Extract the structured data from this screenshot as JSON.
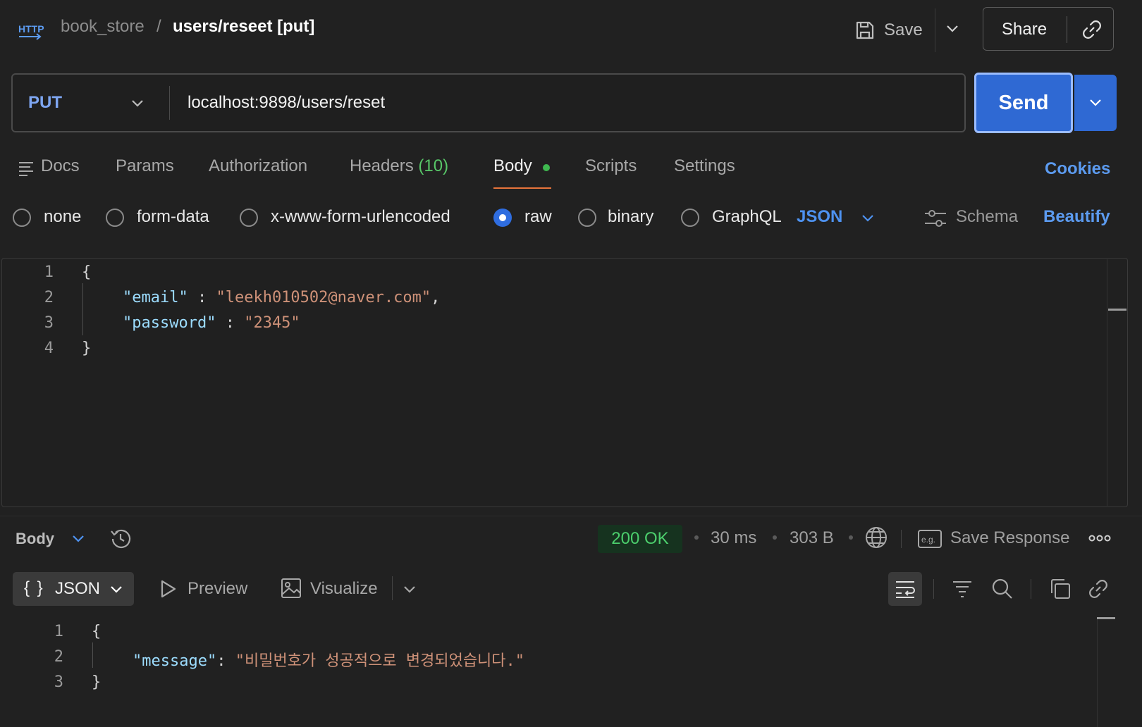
{
  "header": {
    "http_icon": "http-icon",
    "collection": "book_store",
    "separator": "/",
    "request_name": "users/reseet [put]",
    "save_label": "Save",
    "share_label": "Share"
  },
  "request": {
    "method": "PUT",
    "url": "localhost:9898/users/reset",
    "send_label": "Send"
  },
  "tabs": {
    "docs": "Docs",
    "params": "Params",
    "authorization": "Authorization",
    "headers": "Headers",
    "headers_count": "(10)",
    "body": "Body",
    "scripts": "Scripts",
    "settings": "Settings",
    "active": "Body",
    "cookies": "Cookies"
  },
  "body_types": {
    "options": [
      "none",
      "form-data",
      "x-www-form-urlencoded",
      "raw",
      "binary",
      "GraphQL"
    ],
    "selected": "raw",
    "language": "JSON",
    "schema": "Schema",
    "beautify": "Beautify"
  },
  "request_body": {
    "line_numbers": [
      "1",
      "2",
      "3",
      "4"
    ],
    "open_brace": "{",
    "close_brace": "}",
    "email_key": "\"email\"",
    "email_colon": " : ",
    "email_value": "\"leekh010502@naver.com\"",
    "comma": ",",
    "password_key": "\"password\"",
    "password_colon": " : ",
    "password_value": "\"2345\""
  },
  "response": {
    "body_label": "Body",
    "status": "200 OK",
    "time": "30 ms",
    "size": "303 B",
    "save_response": "Save Response",
    "format": "JSON",
    "format_braces": "{ }",
    "preview": "Preview",
    "visualize": "Visualize",
    "line_numbers": [
      "1",
      "2",
      "3"
    ],
    "open_brace": "{",
    "close_brace": "}",
    "message_key": "\"message\"",
    "message_colon": ": ",
    "message_value": "\"비밀번호가 성공적으로 변경되었습니다.\""
  },
  "colors": {
    "background": "#212121",
    "accent_blue": "#2f69d3",
    "tab_underline": "#e8743b",
    "status_green": "#4ccf6d"
  }
}
